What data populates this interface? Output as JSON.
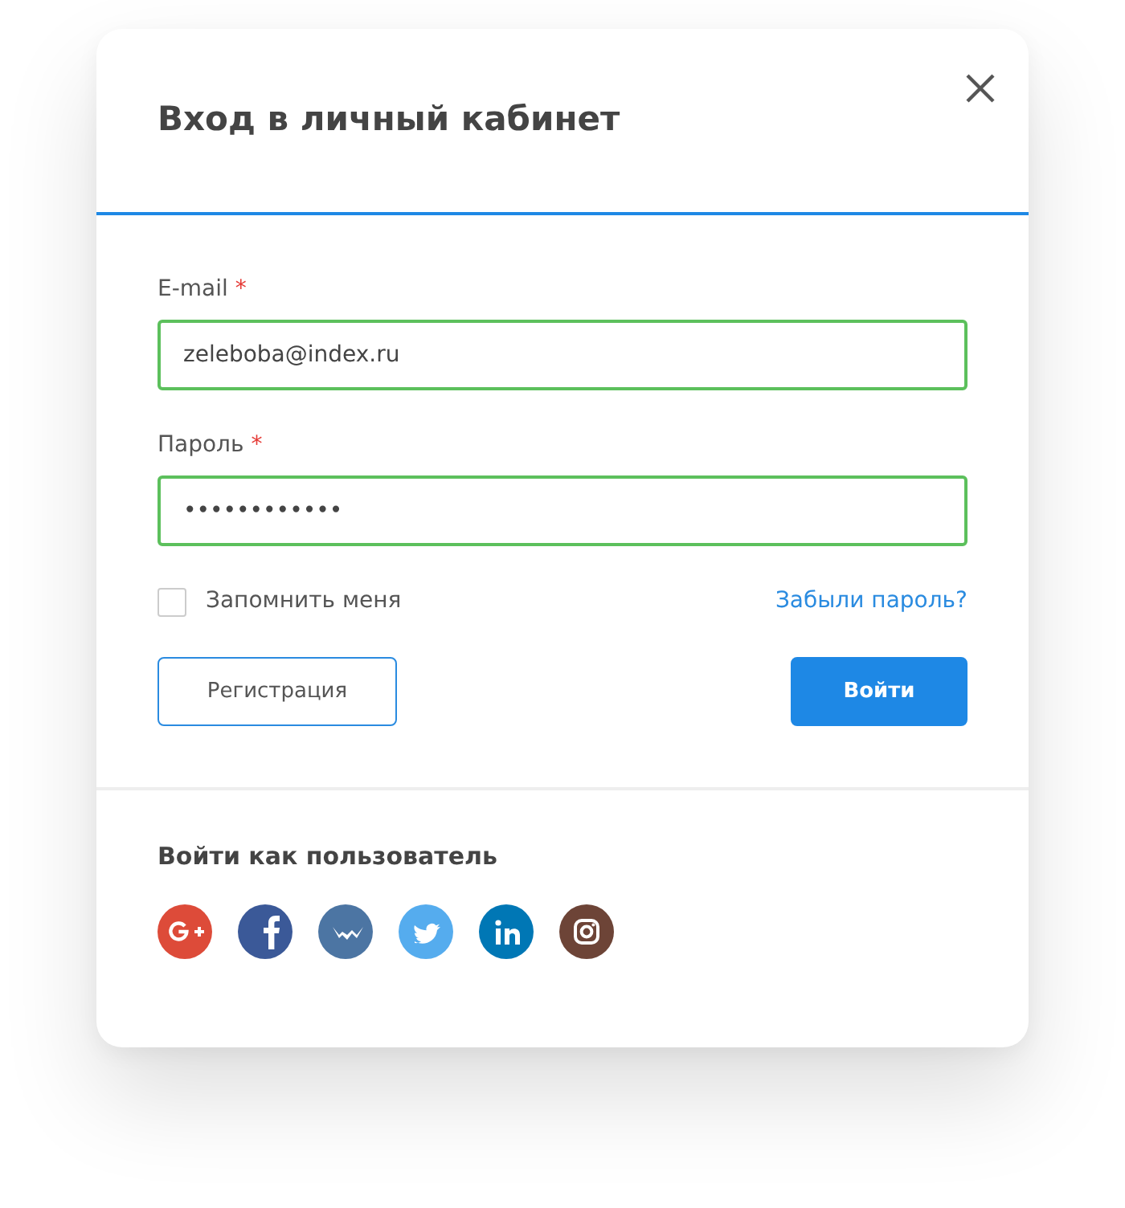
{
  "dialog": {
    "title": "Вход в личный кабинет"
  },
  "fields": [
    {
      "label": "E-mail",
      "required_mark": "*",
      "value": "zeleboba@index.ru",
      "valid": true
    },
    {
      "label": "Пароль",
      "required_mark": "*",
      "value": "••••••••••••",
      "valid": true
    }
  ],
  "remember": {
    "label": "Запомнить меня",
    "checked": false
  },
  "forgot_link": "Забыли пароль?",
  "buttons": [
    {
      "label": "Регистрация",
      "kind": "secondary"
    },
    {
      "label": "Войти",
      "kind": "primary"
    }
  ],
  "social": {
    "title": "Войти как пользователь",
    "networks": [
      {
        "kind": "google-plus",
        "color": "#dd4b39"
      },
      {
        "kind": "facebook",
        "color": "#3b5998"
      },
      {
        "kind": "vk",
        "color": "#4c75a3"
      },
      {
        "kind": "twitter",
        "color": "#55acee"
      },
      {
        "kind": "linkedin",
        "color": "#0077b5"
      },
      {
        "kind": "instagram",
        "color": "#6d4437"
      }
    ]
  }
}
